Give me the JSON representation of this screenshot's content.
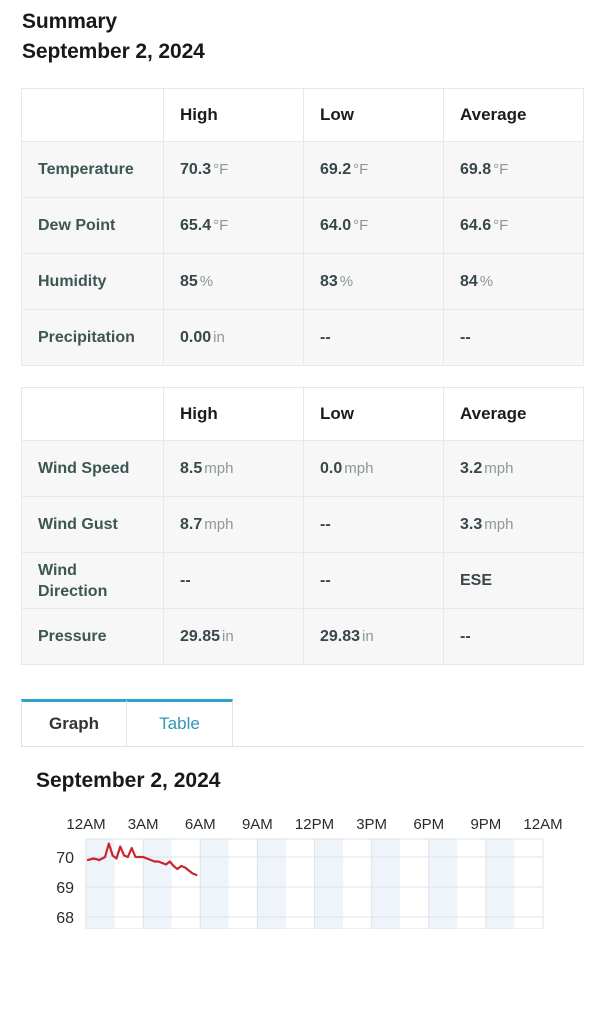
{
  "summary": {
    "title": "Summary",
    "date": "September 2, 2024"
  },
  "table_main": {
    "columns": [
      "",
      "High",
      "Low",
      "Average"
    ],
    "rows": [
      {
        "label": "Temperature",
        "high": "70.3",
        "high_unit": "°F",
        "low": "69.2",
        "low_unit": "°F",
        "avg": "69.8",
        "avg_unit": "°F"
      },
      {
        "label": "Dew Point",
        "high": "65.4",
        "high_unit": "°F",
        "low": "64.0",
        "low_unit": "°F",
        "avg": "64.6",
        "avg_unit": "°F"
      },
      {
        "label": "Humidity",
        "high": "85",
        "high_unit": "%",
        "low": "83",
        "low_unit": "%",
        "avg": "84",
        "avg_unit": "%"
      },
      {
        "label": "Precipitation",
        "high": "0.00",
        "high_unit": "in",
        "low": "--",
        "low_unit": "",
        "avg": "--",
        "avg_unit": ""
      }
    ]
  },
  "table_wind": {
    "columns": [
      "",
      "High",
      "Low",
      "Average"
    ],
    "rows": [
      {
        "label": "Wind Speed",
        "high": "8.5",
        "high_unit": "mph",
        "low": "0.0",
        "low_unit": "mph",
        "avg": "3.2",
        "avg_unit": "mph"
      },
      {
        "label": "Wind Gust",
        "high": "8.7",
        "high_unit": "mph",
        "low": "--",
        "low_unit": "",
        "avg": "3.3",
        "avg_unit": "mph"
      },
      {
        "label": "Wind Direction",
        "high": "--",
        "high_unit": "",
        "low": "--",
        "low_unit": "",
        "avg": "ESE",
        "avg_unit": ""
      },
      {
        "label": "Pressure",
        "high": "29.85",
        "high_unit": "in",
        "low": "29.83",
        "low_unit": "in",
        "avg": "--",
        "avg_unit": ""
      }
    ]
  },
  "tabs": {
    "graph_label": "Graph",
    "table_label": "Table",
    "active": "Graph",
    "accent_color": "#2ba6cb",
    "link_color": "#2f96b4"
  },
  "chart_data": {
    "type": "line",
    "title": "September 2, 2024",
    "xlabel": "",
    "ylabel": "",
    "line_color": "#c9272d",
    "grid": true,
    "legend": "none",
    "xticks": [
      "12AM",
      "3AM",
      "6AM",
      "9AM",
      "12PM",
      "3PM",
      "6PM",
      "9PM",
      "12AM"
    ],
    "yticks": [
      70,
      69,
      68
    ],
    "ylim": [
      67.6,
      70.6
    ],
    "xlim": [
      0,
      24
    ],
    "series": [
      {
        "name": "Temperature",
        "unit": "°F",
        "x": [
          0.1,
          0.4,
          0.7,
          1.0,
          1.2,
          1.4,
          1.6,
          1.8,
          2.0,
          2.2,
          2.4,
          2.6,
          2.8,
          3.0,
          3.2,
          3.4,
          3.6,
          3.8,
          4.0,
          4.2,
          4.4,
          4.6,
          4.8,
          5.0,
          5.2,
          5.4,
          5.6,
          5.8
        ],
        "values": [
          69.9,
          69.95,
          69.9,
          70.0,
          70.45,
          70.05,
          69.95,
          70.35,
          70.05,
          70.0,
          70.3,
          70.0,
          70.0,
          70.0,
          69.95,
          69.9,
          69.85,
          69.85,
          69.8,
          69.75,
          69.85,
          69.7,
          69.6,
          69.7,
          69.65,
          69.55,
          69.45,
          69.4
        ]
      }
    ]
  }
}
